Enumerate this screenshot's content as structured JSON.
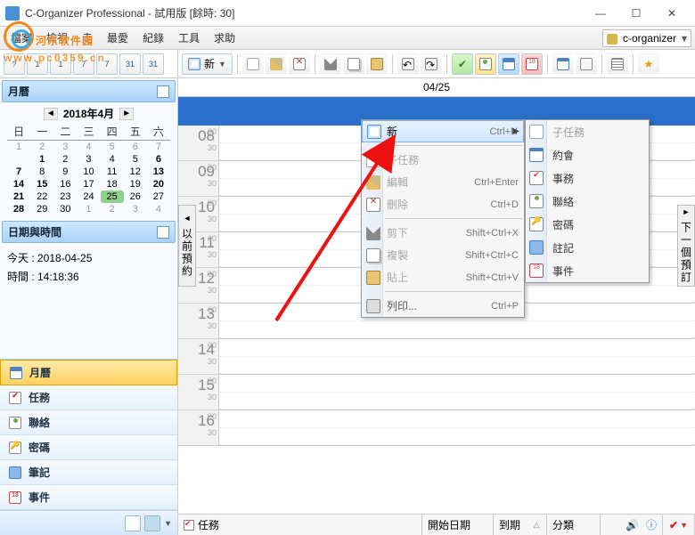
{
  "window": {
    "title": "C-Organizer Professional - 試用版  [餘時: 30]",
    "min": "—",
    "max": "☐",
    "close": "✕"
  },
  "watermark": {
    "text": "河东软件园",
    "sub": "www.pc0359.cn"
  },
  "menubar": {
    "items": [
      "檔案",
      "檢視",
      "走",
      "最愛",
      "紀錄",
      "工具",
      "求助"
    ],
    "db": "c-organizer"
  },
  "left_toolbar_count": 7,
  "main_toolbar": {
    "new_label": "新"
  },
  "sidebar": {
    "cal_header": "月曆",
    "cal_month": "2018年4月",
    "dow": [
      "日",
      "一",
      "二",
      "三",
      "四",
      "五",
      "六"
    ],
    "weeks": [
      [
        {
          "d": "1",
          "dim": true
        },
        {
          "d": "2",
          "dim": true
        },
        {
          "d": "3",
          "dim": true
        },
        {
          "d": "4",
          "dim": true
        },
        {
          "d": "5",
          "dim": true
        },
        {
          "d": "6",
          "dim": true
        },
        {
          "d": "7",
          "dim": true
        }
      ],
      [
        {
          "d": "",
          "dim": true
        },
        {
          "d": "1",
          "bold": true
        },
        {
          "d": "2"
        },
        {
          "d": "3"
        },
        {
          "d": "4"
        },
        {
          "d": "5"
        },
        {
          "d": "6",
          "bold": true
        }
      ],
      [
        {
          "d": "7",
          "bold": true
        },
        {
          "d": "8"
        },
        {
          "d": "9"
        },
        {
          "d": "10"
        },
        {
          "d": "11"
        },
        {
          "d": "12"
        },
        {
          "d": "13",
          "bold": true
        }
      ],
      [
        {
          "d": "14",
          "bold": true
        },
        {
          "d": "15",
          "bold": true
        },
        {
          "d": "16"
        },
        {
          "d": "17"
        },
        {
          "d": "18"
        },
        {
          "d": "19"
        },
        {
          "d": "20",
          "bold": true
        }
      ],
      [
        {
          "d": "21",
          "bold": true
        },
        {
          "d": "22"
        },
        {
          "d": "23"
        },
        {
          "d": "24"
        },
        {
          "d": "25",
          "today": true
        },
        {
          "d": "26"
        },
        {
          "d": "27"
        },
        {
          "d": "28",
          "bold": true
        }
      ],
      [
        {
          "d": "28",
          "bold": true
        },
        {
          "d": "29"
        },
        {
          "d": "30"
        },
        {
          "d": "1",
          "dim": true
        },
        {
          "d": "2",
          "dim": true
        },
        {
          "d": "3",
          "dim": true
        },
        {
          "d": "4",
          "dim": true
        }
      ]
    ],
    "dt_header": "日期與時間",
    "today_label": "今天 : 2018-04-25",
    "time_label": "時間 : 14:18:36",
    "nav": [
      {
        "label": "月曆",
        "icon": "ic-cal",
        "sel": true
      },
      {
        "label": "任務",
        "icon": "ic-task"
      },
      {
        "label": "聯絡",
        "icon": "ic-contact"
      },
      {
        "label": "密碼",
        "icon": "ic-key"
      },
      {
        "label": "筆記",
        "icon": "ic-note"
      },
      {
        "label": "事件",
        "icon": "ic-event"
      }
    ]
  },
  "calendar": {
    "date_header": "04/25",
    "hours": [
      "08",
      "09",
      "10",
      "11",
      "12",
      "13",
      "14",
      "15",
      "16"
    ],
    "mins": [
      "00",
      "30"
    ],
    "left_tab": "以前預約",
    "right_tab": "下一個預訂"
  },
  "ctx": {
    "items": [
      {
        "label": "新",
        "shortcut": "Ctrl+N",
        "icon": "ic-doc",
        "sel": true,
        "sub": true
      },
      {
        "sep": true
      },
      {
        "label": "子任務",
        "icon": "ic-subtask",
        "dim": true
      },
      {
        "label": "編輯",
        "shortcut": "Ctrl+Enter",
        "icon": "ic-edit",
        "dim": true
      },
      {
        "label": "刪除",
        "shortcut": "Ctrl+D",
        "icon": "ic-del",
        "dim": true
      },
      {
        "sep": true
      },
      {
        "label": "剪下",
        "shortcut": "Shift+Ctrl+X",
        "icon": "ic-cut",
        "dim": true
      },
      {
        "label": "複製",
        "shortcut": "Shift+Ctrl+C",
        "icon": "ic-copy",
        "dim": true
      },
      {
        "label": "貼上",
        "shortcut": "Shift+Ctrl+V",
        "icon": "ic-paste",
        "dim": true
      },
      {
        "sep": true
      },
      {
        "label": "列印...",
        "shortcut": "Ctrl+P",
        "icon": "ic-print"
      }
    ]
  },
  "submenu": {
    "items": [
      {
        "label": "子任務",
        "icon": "ic-subtask",
        "dim": true
      },
      {
        "label": "約會",
        "icon": "ic-appt"
      },
      {
        "label": "事務",
        "icon": "ic-task"
      },
      {
        "label": "聯絡",
        "icon": "ic-contact"
      },
      {
        "label": "密碼",
        "icon": "ic-key"
      },
      {
        "label": "註記",
        "icon": "ic-note"
      },
      {
        "label": "事件",
        "icon": "ic-event"
      }
    ]
  },
  "taskbar": {
    "task": "任務",
    "start": "開始日期",
    "due": "到期",
    "category": "分類"
  }
}
